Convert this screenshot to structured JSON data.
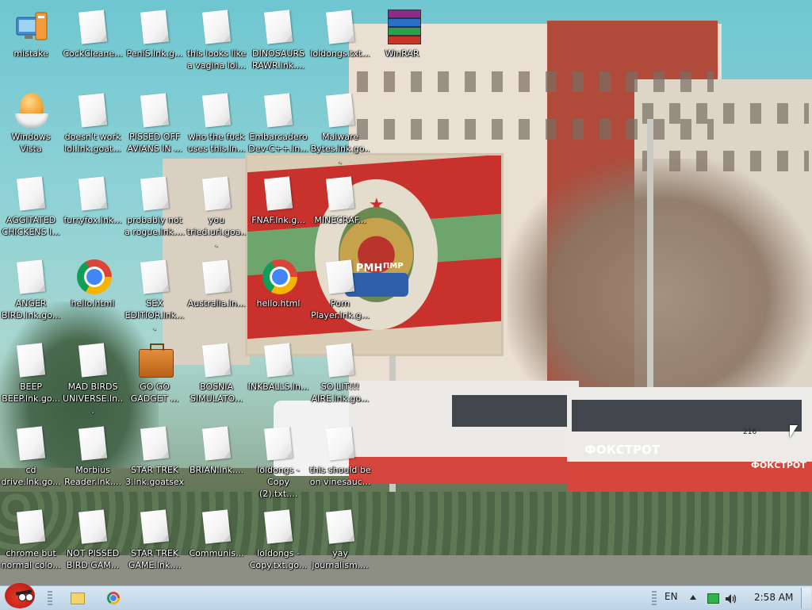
{
  "desktop": {
    "icons": [
      {
        "label": "mistake",
        "icon": "mistake-app-icon"
      },
      {
        "label": "CockCleane...",
        "icon": "shortcut-file-icon"
      },
      {
        "label": "PeniS.lnk.g...",
        "icon": "shortcut-file-icon"
      },
      {
        "label": "this looks like\na vagina lol...",
        "icon": "shortcut-file-icon"
      },
      {
        "label": "DINOSAURS\nRAWR.lnk....",
        "icon": "shortcut-file-icon"
      },
      {
        "label": "loldongs.txt...",
        "icon": "shortcut-file-icon"
      },
      {
        "label": "WinRAR",
        "icon": "winrar-icon"
      },
      {
        "label": "Windows\nVista",
        "icon": "windows-vista-icon"
      },
      {
        "label": "doesn't work\nlol.lnk.goat...",
        "icon": "shortcut-file-icon"
      },
      {
        "label": "PISSED OFF\nAVIANS IN ...",
        "icon": "shortcut-file-icon"
      },
      {
        "label": "who the fuck\nuses this.ln...",
        "icon": "shortcut-file-icon"
      },
      {
        "label": "Embarcadero\nDev-C++.ln...",
        "icon": "shortcut-file-icon"
      },
      {
        "label": "Malware\nBytes.lnk.go...",
        "icon": "shortcut-file-icon"
      },
      {
        "label": "AGGITATED\nCHICKENS I...",
        "icon": "shortcut-file-icon"
      },
      {
        "label": "furryfox.lnk...",
        "icon": "shortcut-file-icon"
      },
      {
        "label": "probably not\na rogue.lnk....",
        "icon": "shortcut-file-icon"
      },
      {
        "label": "you\ntried.url.goa...",
        "icon": "shortcut-file-icon"
      },
      {
        "label": "FNAF.lnk.g...",
        "icon": "shortcut-file-icon"
      },
      {
        "label": "MINECRAF...",
        "icon": "shortcut-file-icon"
      },
      {
        "label": "ANGER\nBIRD.lnk.go...",
        "icon": "shortcut-file-icon"
      },
      {
        "label": "hello.html",
        "icon": "chrome-icon"
      },
      {
        "label": "SEX\nEDITIOR.lnk....",
        "icon": "shortcut-file-icon"
      },
      {
        "label": "Australia.ln...",
        "icon": "shortcut-file-icon"
      },
      {
        "label": "hello.html",
        "icon": "chrome-icon"
      },
      {
        "label": "Porn\nPlayer.lnk.g...",
        "icon": "shortcut-file-icon"
      },
      {
        "label": "BEEP\nBEEP.lnk.go...",
        "icon": "shortcut-file-icon"
      },
      {
        "label": "MAD BIRDS\nUNIVERSE.ln...",
        "icon": "shortcut-file-icon"
      },
      {
        "label": "GO GO\nGADGET ...",
        "icon": "briefcase-icon"
      },
      {
        "label": "BOSNIA\nSIMULATO...",
        "icon": "shortcut-file-icon"
      },
      {
        "label": "INKBALLS.ln...",
        "icon": "shortcut-file-icon"
      },
      {
        "label": "SO LIT!!!\nAIRE.lnk.go...",
        "icon": "shortcut-file-icon"
      },
      {
        "label": "cd\ndrive.lnk.go...",
        "icon": "shortcut-file-icon"
      },
      {
        "label": "Morbius\nReader.lnk....",
        "icon": "shortcut-file-icon"
      },
      {
        "label": "STAR TREK\n3.lnk.goatsex",
        "icon": "shortcut-file-icon"
      },
      {
        "label": "BRIAN.lnk....",
        "icon": "shortcut-file-icon"
      },
      {
        "label": "loldongs -\nCopy (2).txt....",
        "icon": "shortcut-file-icon"
      },
      {
        "label": "this should be\non vinesauc...",
        "icon": "shortcut-file-icon"
      },
      {
        "label": "chrome but\nnormal colo...",
        "icon": "shortcut-file-icon"
      },
      {
        "label": "NOT PISSED\nBIRD GAM...",
        "icon": "shortcut-file-icon"
      },
      {
        "label": "STAR TREK\nGAME.lnk....",
        "icon": "shortcut-file-icon"
      },
      {
        "label": "Communis...",
        "icon": "shortcut-file-icon"
      },
      {
        "label": "loldongs -\nCopy.txt.go...",
        "icon": "shortcut-file-icon"
      },
      {
        "label": "yay\njournalism....",
        "icon": "shortcut-file-icon"
      }
    ]
  },
  "wallpaper": {
    "bus_sign_1": "ФОКСТРОТ",
    "bus_sign_2": "ФОКСТРОТ",
    "bus_number": "216",
    "emblem_text": "РМН",
    "emblem_ribbon": "ПМР"
  },
  "taskbar": {
    "start_icon": "angry-bird-icon",
    "pinned": [
      {
        "name": "file-explorer-icon"
      },
      {
        "name": "chrome-icon"
      }
    ],
    "tray": {
      "language": "EN",
      "time": "2:58 AM"
    }
  },
  "colors": {
    "taskbar_top": "#d6e6f2",
    "taskbar_bottom": "#bcd3e6",
    "icon_label": "#ffffff",
    "flag_red": "#c9312d",
    "flag_green": "#6ea56c"
  }
}
